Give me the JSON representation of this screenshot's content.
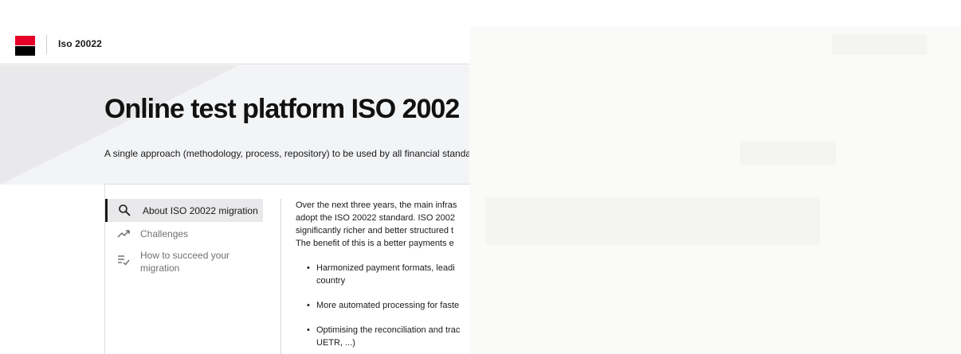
{
  "header": {
    "app_title": "Iso 20022"
  },
  "hero": {
    "title": "Online test platform ISO 2002",
    "subtitle": "A single approach (methodology, process, repository) to be used by all financial standar"
  },
  "sidebar": {
    "items": [
      {
        "label": "About ISO 20022 migration",
        "icon": "search-icon",
        "active": true
      },
      {
        "label": "Challenges",
        "icon": "trending-up-icon",
        "active": false
      },
      {
        "label_line1": "How to succeed your",
        "label_line2": "migration",
        "icon": "checklist-icon",
        "active": false
      }
    ]
  },
  "content": {
    "paragraph_lines": [
      "Over the next three years, the main infras",
      "adopt the ISO 20022 standard. ISO 2002",
      "significantly richer and better structured t",
      "The benefit of this is a better payments e"
    ],
    "bullets": [
      {
        "line1": "Harmonized payment formats, leadi",
        "line2": "country"
      },
      {
        "line1": "More automated processing for faste"
      },
      {
        "line1": "Optimising the reconciliation and trac",
        "line2": "UETR, ...)"
      }
    ]
  },
  "colors": {
    "brand_red": "#e60028",
    "brand_black": "#000000",
    "hero_bg": "#f3f4f6"
  }
}
